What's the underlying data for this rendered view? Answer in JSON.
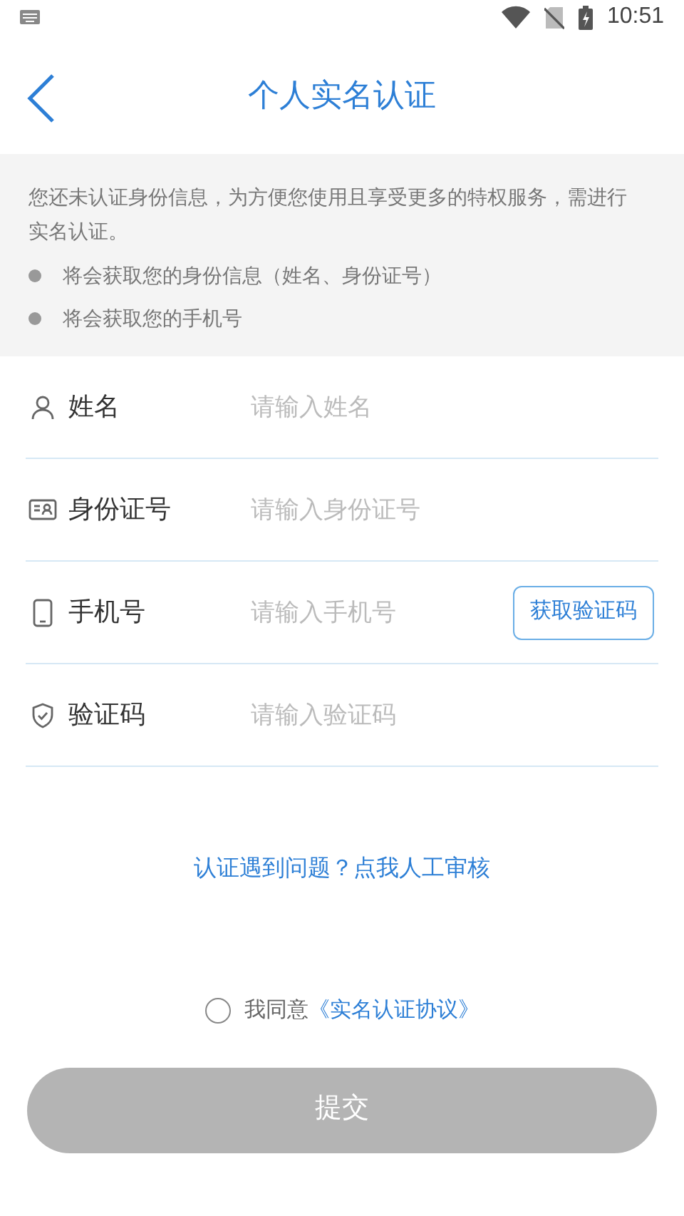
{
  "status_bar": {
    "time": "10:51"
  },
  "header": {
    "title": "个人实名认证"
  },
  "notice": {
    "text": "您还未认证身份信息，为方便您使用且享受更多的特权服务，需进行实名认证。",
    "bullets": [
      "将会获取您的身份信息（姓名、身份证号）",
      "将会获取您的手机号"
    ]
  },
  "fields": [
    {
      "kind": "person",
      "label": "姓名",
      "placeholder": "请输入姓名"
    },
    {
      "kind": "idcard",
      "label": "身份证号",
      "placeholder": "请输入身份证号"
    },
    {
      "kind": "phone",
      "label": "手机号",
      "placeholder": "请输入手机号",
      "button": "获取验证码"
    },
    {
      "kind": "shield",
      "label": "验证码",
      "placeholder": "请输入验证码"
    }
  ],
  "help_link": "认证遇到问题？点我人工审核",
  "agreement": {
    "checked": false,
    "prefix": "我同意",
    "link": "《实名认证协议》"
  },
  "submit": {
    "label": "提交",
    "disabled": true
  }
}
